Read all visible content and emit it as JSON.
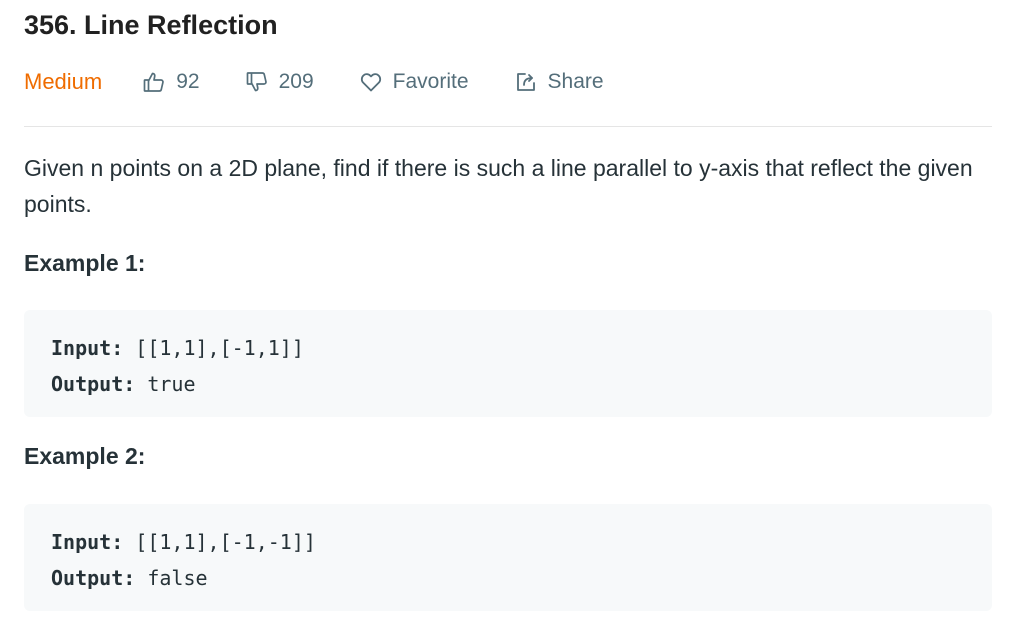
{
  "problem": {
    "title": "356. Line Reflection",
    "difficulty": "Medium",
    "likes": "92",
    "dislikes": "209",
    "favorite_label": "Favorite",
    "share_label": "Share",
    "description": "Given n points on a 2D plane, find if there is such a line parallel to y-axis that reflect the given points."
  },
  "examples": [
    {
      "heading": "Example 1:",
      "input_label": "Input:",
      "input": "[[1,1],[-1,1]]",
      "output_label": "Output:",
      "output": "true"
    },
    {
      "heading": "Example 2:",
      "input_label": "Input:",
      "input": "[[1,1],[-1,-1]]",
      "output_label": "Output:",
      "output": "false"
    }
  ],
  "colors": {
    "difficulty_medium": "#ef6c00",
    "meta_text": "#546e7a",
    "code_background": "#f7f9fa"
  },
  "icons": [
    "thumbs-up-icon",
    "thumbs-down-icon",
    "heart-icon",
    "share-icon"
  ]
}
